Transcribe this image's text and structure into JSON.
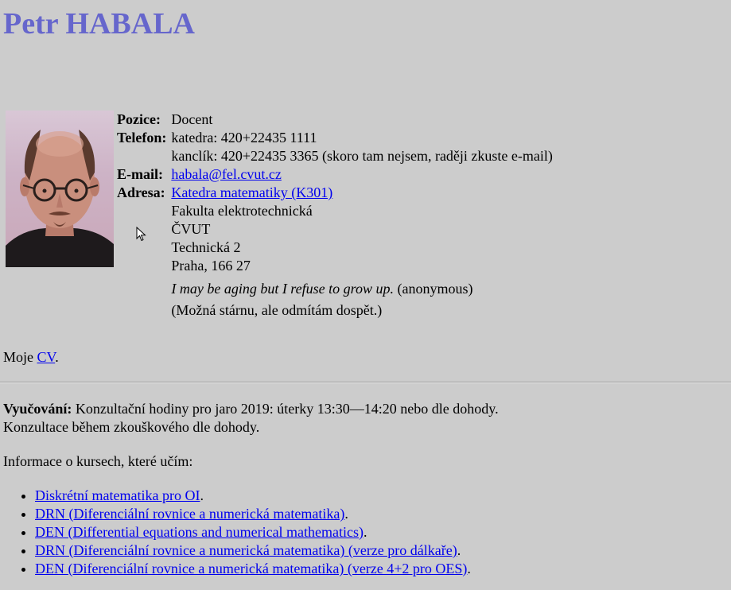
{
  "page": {
    "title": "Petr HABALA"
  },
  "profile": {
    "photo_alt": "portrait-photo",
    "rows": {
      "position": {
        "label": "Pozice:",
        "value": "Docent"
      },
      "phone": {
        "label": "Telefon:",
        "line1": "katedra: 420+22435 1111",
        "line2": "kanclík: 420+22435 3365 (skoro tam nejsem, raději zkuste e-mail)"
      },
      "email": {
        "label": "E-mail:",
        "value": "habala@fel.cvut.cz"
      },
      "address": {
        "label": "Adresa:",
        "link": "Katedra matematiky (K301)",
        "line2": "Fakulta elektrotechnická",
        "line3": "ČVUT",
        "line4": "Technická 2",
        "line5": "Praha, 166 27"
      }
    },
    "quote": {
      "text": "I may be aging but I refuse to grow up.",
      "attribution": " (anonymous)",
      "translation": "(Možná stárnu, ale odmítám dospět.)"
    }
  },
  "cv": {
    "prefix": "Moje ",
    "link": "CV",
    "suffix": "."
  },
  "teaching": {
    "label": "Vyučování:",
    "text": " Konzultační hodiny pro jaro 2019: úterky 13:30—14:20 nebo dle dohody.",
    "line2": "Konzultace během zkouškového dle dohody."
  },
  "courses": {
    "intro": "Informace o kursech, které učím:",
    "items": [
      {
        "link": "Diskrétní matematika pro OI",
        "suffix": "."
      },
      {
        "link": "DRN (Diferenciální rovnice a numerická matematika)",
        "suffix": "."
      },
      {
        "link": "DEN (Differential equations and numerical mathematics)",
        "suffix": "."
      },
      {
        "link": "DRN (Diferenciální rovnice a numerická matematika) (verze pro dálkaře)",
        "suffix": "."
      },
      {
        "link": "DEN (Diferenciální rovnice a numerická matematika) (verze 4+2 pro OES)",
        "suffix": "."
      }
    ]
  },
  "colors": {
    "background": "#cccccc",
    "title": "#6666cc",
    "link": "#0000ee"
  }
}
